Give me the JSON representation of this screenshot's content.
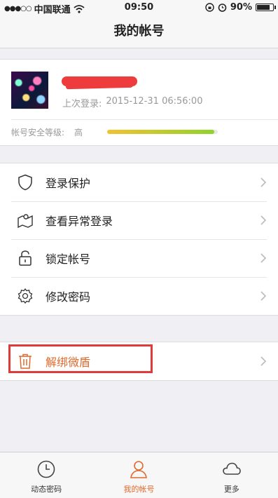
{
  "status_bar": {
    "carrier": "中国联通",
    "time": "09:50",
    "battery_percent": "90%"
  },
  "nav": {
    "title": "我的帐号"
  },
  "profile": {
    "last_login_label": "上次登录:",
    "last_login_time": "2015-12-31 06:56:00",
    "security_label": "帐号安全等级:",
    "security_level": "高",
    "security_progress": 0.97
  },
  "menu": {
    "items": [
      {
        "label": "登录保护",
        "icon": "shield-icon"
      },
      {
        "label": "查看异常登录",
        "icon": "map-pin-icon"
      },
      {
        "label": "锁定帐号",
        "icon": "lock-icon"
      },
      {
        "label": "修改密码",
        "icon": "gear-icon"
      }
    ]
  },
  "unbind": {
    "label": "解绑微盾",
    "icon": "trash-icon"
  },
  "tabs": [
    {
      "label": "动态密码",
      "icon": "clock-icon",
      "active": false
    },
    {
      "label": "我的帐号",
      "icon": "user-icon",
      "active": true
    },
    {
      "label": "更多",
      "icon": "cloud-icon",
      "active": false
    }
  ],
  "colors": {
    "accent": "#e06a2c",
    "highlight": "#e03a3a"
  }
}
